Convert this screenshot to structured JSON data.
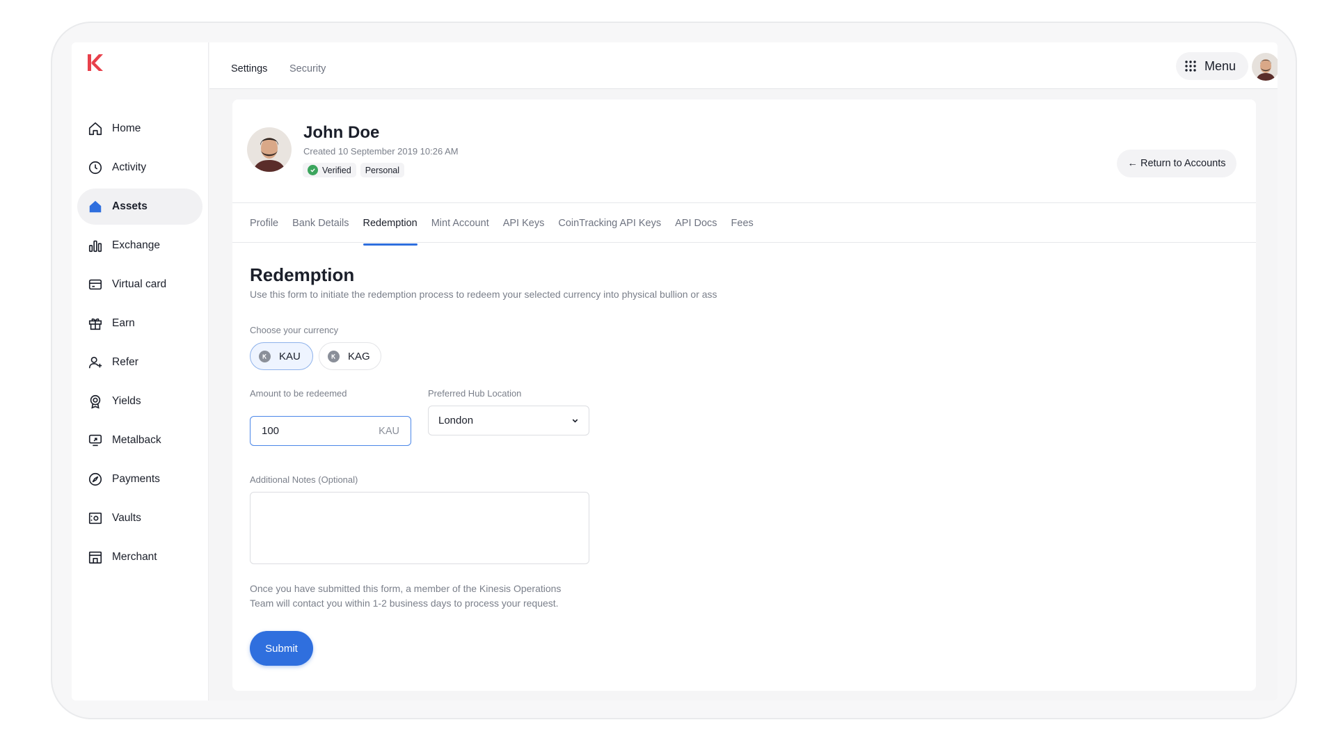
{
  "brand": {
    "accent": "#2f6fde",
    "logo_color": "#e8404b"
  },
  "sidebar": {
    "items": [
      {
        "label": "Home",
        "icon": "home-icon"
      },
      {
        "label": "Activity",
        "icon": "clock-icon"
      },
      {
        "label": "Assets",
        "icon": "home-filled-icon",
        "active": true
      },
      {
        "label": "Exchange",
        "icon": "bar-chart-icon"
      },
      {
        "label": "Virtual card",
        "icon": "card-icon"
      },
      {
        "label": "Earn",
        "icon": "gift-icon"
      },
      {
        "label": "Refer",
        "icon": "user-plus-icon"
      },
      {
        "label": "Yields",
        "icon": "badge-icon"
      },
      {
        "label": "Metalback",
        "icon": "screen-arrow-icon"
      },
      {
        "label": "Payments",
        "icon": "compass-icon"
      },
      {
        "label": "Vaults",
        "icon": "vault-icon"
      },
      {
        "label": "Merchant",
        "icon": "store-icon"
      }
    ]
  },
  "header": {
    "tabs": [
      "Settings",
      "Security"
    ],
    "menu_label": "Menu"
  },
  "profile": {
    "name": "John Doe",
    "created": "Created 10 September 2019 10:26 AM",
    "badge_verified": "Verified",
    "badge_type": "Personal",
    "return_label": "← Return to Accounts"
  },
  "tabs": [
    "Profile",
    "Bank Details",
    "Redemption",
    "Mint Account",
    "API Keys",
    "CoinTracking API Keys",
    "API Docs",
    "Fees"
  ],
  "active_tab": "Redemption",
  "form": {
    "title": "Redemption",
    "description": "Use this form to initiate the redemption process to redeem your selected currency into physical bullion or ass",
    "currency_label": "Choose your currency",
    "currencies": [
      "KAU",
      "KAG"
    ],
    "selected_currency": "KAU",
    "amount_label": "Amount to be redeemed",
    "amount_value": "100",
    "amount_unit": "KAU",
    "hub_label": "Preferred Hub Location",
    "hub_value": "London",
    "notes_label": "Additional Notes (Optional)",
    "notes_value": "",
    "info_text": "Once you have submitted this form, a member of the Kinesis Operations Team will contact you within 1-2 business days to process your request.",
    "submit_label": "Submit"
  }
}
